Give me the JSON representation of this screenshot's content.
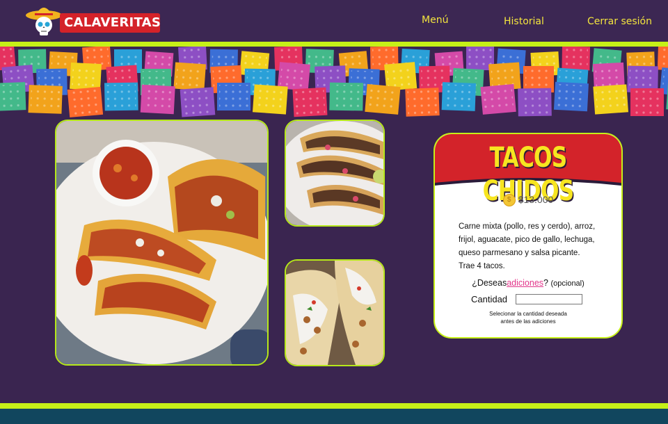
{
  "brand": {
    "name": "CALAVERITAS"
  },
  "nav": {
    "menu": "Menú",
    "history": "Historial",
    "logout": "Cerrar sesión"
  },
  "product": {
    "title": "TACOS CHIDOS",
    "price": "$13.000",
    "description_lines": [
      "Carne mixta (pollo, res y cerdo), arroz,",
      "frijol, aguacate, pico de gallo, lechuga,",
      "queso parmesano y salsa picante.",
      "Trae 4 tacos."
    ],
    "addons_prefix": "¿Deseas",
    "addons_link": "adiciones",
    "addons_suffix": "?",
    "addons_optional": "(opcional)",
    "quantity_label": "Cantidad",
    "quantity_value": "",
    "note_lines": [
      "Selecionar la cantidad deseada",
      "antes de las adiciones"
    ]
  },
  "colors": {
    "background": "#3a2550",
    "accent_green": "#c6f018",
    "nav_yellow": "#f4e53e",
    "card_red": "#d3232a",
    "title_yellow": "#f7e520",
    "link_pink": "#e2358a",
    "footer_teal": "#11465e"
  },
  "icons": [
    "calaverita-logo-icon",
    "coin-icon"
  ]
}
